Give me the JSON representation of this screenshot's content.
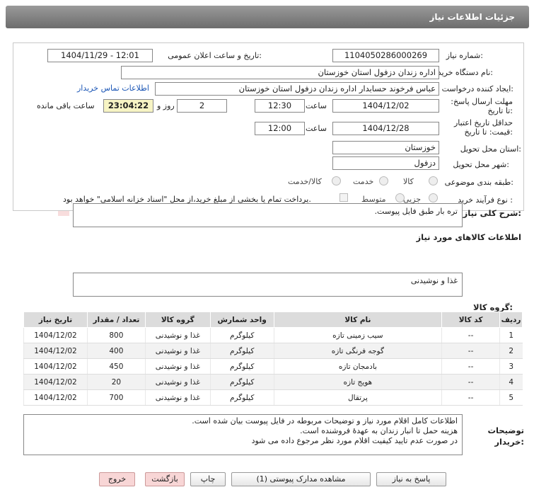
{
  "header": {
    "title": "جزئیات اطلاعات نیاز"
  },
  "labels": {
    "need_number": "شماره نیاز:",
    "announce_datetime": "تاریخ و ساعت اعلان عمومی:",
    "buyer_org": "نام دستگاه خریدار:",
    "creator": "ایجاد کننده درخواست:",
    "reply_deadline": "مهلت ارسال پاسخ: تا تاریخ:",
    "time": "ساعت",
    "day_and": "روز و",
    "time_left": "ساعت باقی مانده",
    "min_validity": "حداقل تاریخ اعتبار قیمت: تا تاریخ:",
    "delivery_province": "استان محل تحویل:",
    "delivery_city": "شهر محل تحویل:",
    "category": "طبقه بندی موضوعی:",
    "process_type": "نوع فرآیند خرید :",
    "general_desc": "شرح کلی نیاز:",
    "goods_info": "اطلاعات کالاهای مورد نیاز",
    "goods_group": "گروه کالا:",
    "buyer_notes": "توضیحات خریدار:"
  },
  "fields": {
    "need_number": "1104050286000269",
    "announce_datetime": "1404/11/29 - 12:01",
    "buyer_org": "اداره زندان دزفول استان خوزستان",
    "creator": "عباس فرخوند حسابدار اداره زندان دزفول استان خوزستان",
    "contact_link": "اطلاعات تماس خریدار",
    "reply_date": "1404/12/02",
    "reply_time": "12:30",
    "days_left": "2",
    "time_left": "23:04:22",
    "validity_date": "1404/12/28",
    "validity_time": "12:00",
    "province": "خوزستان",
    "city": "دزفول"
  },
  "category_options": [
    "کالا",
    "خدمت",
    "کالا/خدمت"
  ],
  "process_options": [
    "جزیی",
    "متوسط"
  ],
  "process_payment_note": "پرداخت تمام یا بخشی از مبلغ خرید،از محل \"اسناد خزانه اسلامی\" خواهد بود.",
  "general_desc": "تره بار طبق فایل پیوست.",
  "goods_group": "غذا و نوشیدنی",
  "table": {
    "headers": [
      "ردیف",
      "کد کالا",
      "نام کالا",
      "واحد شمارش",
      "گروه کالا",
      "تعداد / مقدار",
      "تاریخ نیاز"
    ],
    "rows": [
      [
        "1",
        "--",
        "سیب زمینی تازه",
        "کیلوگرم",
        "غذا و نوشیدنی",
        "800",
        "1404/12/02"
      ],
      [
        "2",
        "--",
        "گوجه فرنگی تازه",
        "کیلوگرم",
        "غذا و نوشیدنی",
        "400",
        "1404/12/02"
      ],
      [
        "3",
        "--",
        "بادمجان تازه",
        "کیلوگرم",
        "غذا و نوشیدنی",
        "450",
        "1404/12/02"
      ],
      [
        "4",
        "--",
        "هویج تازه",
        "کیلوگرم",
        "غذا و نوشیدنی",
        "20",
        "1404/12/02"
      ],
      [
        "5",
        "--",
        "پرتقال",
        "کیلوگرم",
        "غذا و نوشیدنی",
        "700",
        "1404/12/02"
      ]
    ]
  },
  "buyer_notes": [
    "اطلاعات کامل اقلام مورد نیاز و توضیحات مربوطه در فایل پیوست بیان شده است.",
    "هزینه حمل تا انبار زندان به عهدهٔ فروشنده است.",
    "در صورت عدم تایید کیفیت اقلام مورد نظر مرجوع داده می شود"
  ],
  "buttons": {
    "reply": "پاسخ به نیاز",
    "attachments": "مشاهده مدارک پیوستی (1)",
    "print": "چاپ",
    "back": "بازگشت",
    "exit": "خروج"
  },
  "watermark": "AriaTender.net"
}
